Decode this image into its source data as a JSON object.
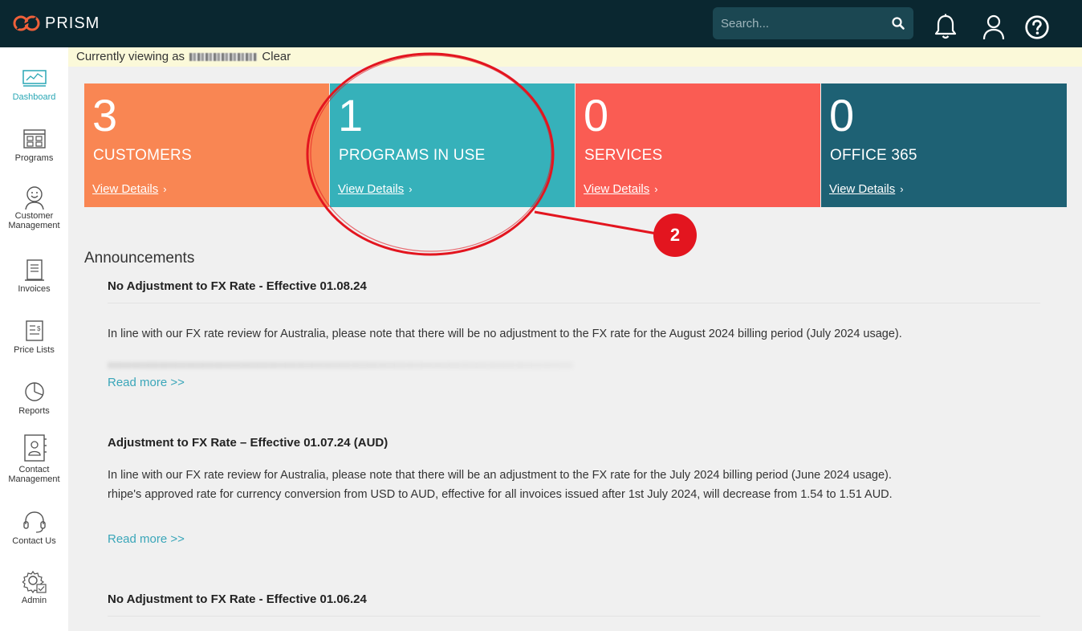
{
  "app": {
    "name": "PRISM"
  },
  "search": {
    "placeholder": "Search..."
  },
  "sidebar": {
    "items": [
      {
        "label": "Dashboard"
      },
      {
        "label": "Programs"
      },
      {
        "label": "Customer Management"
      },
      {
        "label": "Invoices"
      },
      {
        "label": "Price Lists"
      },
      {
        "label": "Reports"
      },
      {
        "label": "Contact Management"
      },
      {
        "label": "Contact Us"
      },
      {
        "label": "Admin"
      }
    ]
  },
  "viewing": {
    "prefix": "Currently viewing as",
    "clear": "Clear"
  },
  "tiles": [
    {
      "count": "3",
      "label": "CUSTOMERS",
      "link": "View Details",
      "color": "#f98653"
    },
    {
      "count": "1",
      "label": "PROGRAMS IN USE",
      "link": "View Details",
      "color": "#36b1ba"
    },
    {
      "count": "0",
      "label": "SERVICES",
      "link": "View Details",
      "color": "#fa5c53"
    },
    {
      "count": "0",
      "label": "OFFICE 365",
      "link": "View Details",
      "color": "#1e6174"
    }
  ],
  "annotation": {
    "number": "2",
    "color": "#e3151f"
  },
  "announcements": {
    "title": "Announcements",
    "items": [
      {
        "heading": "No Adjustment to FX Rate - Effective 01.08.24",
        "body1": "In line with our FX rate review for Australia, please note that there will be no adjustment to the FX rate for the August 2024 billing period (July 2024 usage).",
        "read_more": "Read more >>"
      },
      {
        "heading": "Adjustment to FX Rate – Effective 01.07.24 (AUD)",
        "body1": "In line with our FX rate review for Australia, please note that there will be an adjustment to the FX rate for the July 2024 billing period (June 2024 usage).",
        "body2": "rhipe's approved rate for currency conversion from USD to AUD, effective for all invoices issued after 1st July 2024, will decrease from 1.54 to 1.51 AUD.",
        "read_more": "Read more >>"
      },
      {
        "heading": "No Adjustment to FX Rate - Effective 01.06.24"
      }
    ]
  }
}
